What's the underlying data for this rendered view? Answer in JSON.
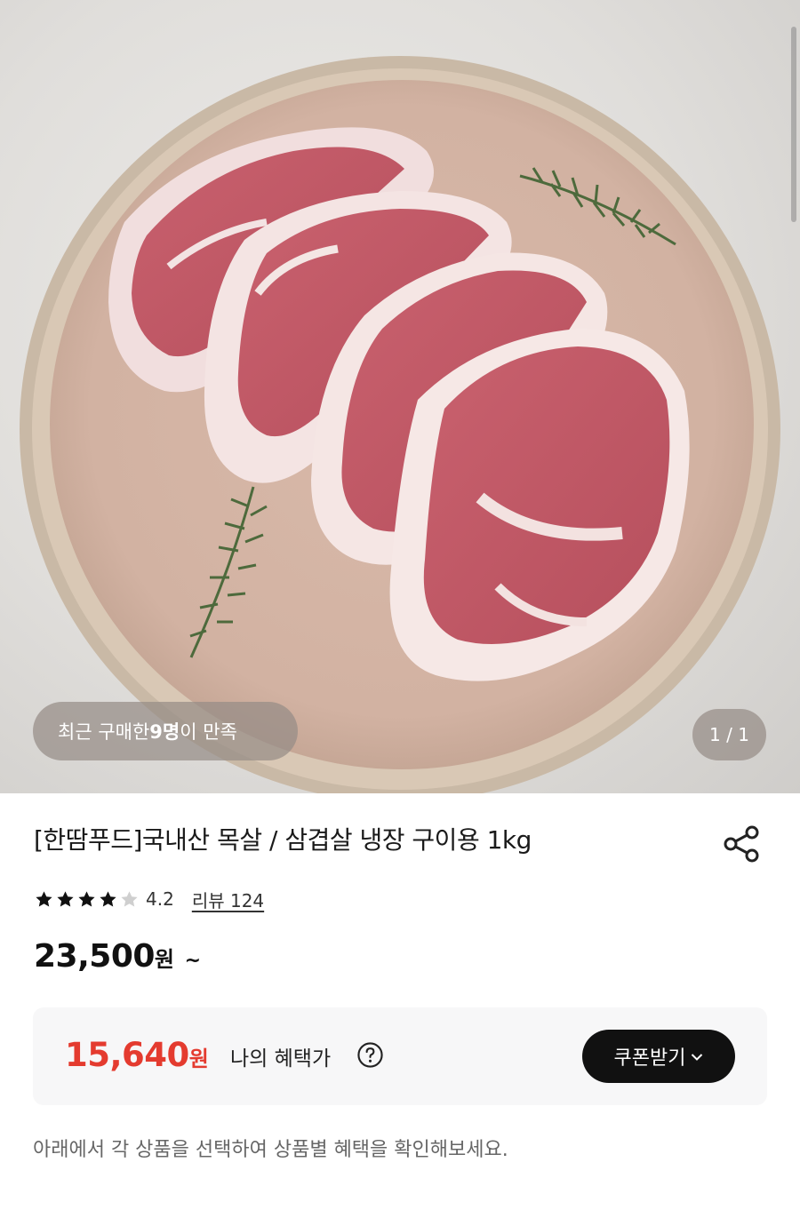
{
  "image": {
    "buyers_prefix": "최근 구매한 ",
    "buyers_count": "9명",
    "buyers_suffix": "이 만족",
    "counter": "1 / 1"
  },
  "product": {
    "title": "[한땀푸드]국내산 목살 / 삼겹살 냉장 구이용 1kg",
    "rating": 4.2,
    "rating_text": "4.2",
    "stars_filled": 4,
    "stars_total": 5,
    "review_link": "리뷰 124",
    "price_value": "23,500",
    "price_unit": "원",
    "price_suffix": "~"
  },
  "benefit": {
    "price_value": "15,640",
    "price_unit": "원",
    "label": "나의 혜택가",
    "coupon_button": "쿠폰받기"
  },
  "guide_text": "아래에서 각 상품을 선택하여 상품별 혜택을 확인해보세요.",
  "colors": {
    "accent_red": "#e43b2f",
    "button_black": "#111111",
    "benefit_bg": "#f7f7f8"
  },
  "icons": [
    "share-icon",
    "star-icon",
    "help-circle-icon",
    "chevron-down-icon"
  ]
}
